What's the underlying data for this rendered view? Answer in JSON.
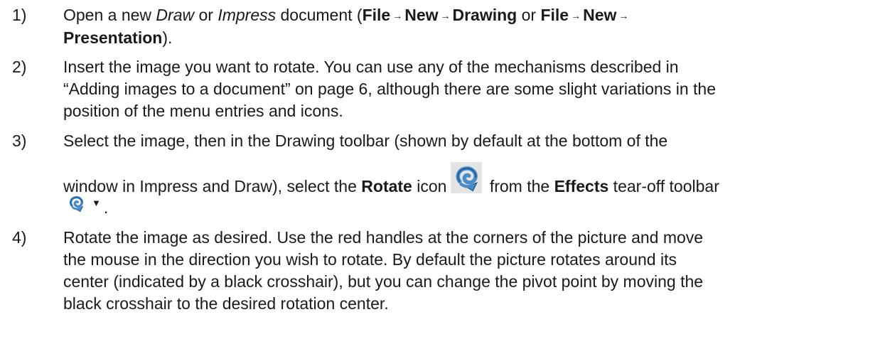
{
  "steps": [
    {
      "number": "1)",
      "lines": [
        [
          {
            "t": "Open a new "
          },
          {
            "t": "Draw",
            "s": "i"
          },
          {
            "t": " or "
          },
          {
            "t": "Impress",
            "s": "i"
          },
          {
            "t": " document ("
          },
          {
            "t": "File",
            "s": "b"
          },
          {
            "t": "→",
            "s": "arrow"
          },
          {
            "t": "New",
            "s": "b"
          },
          {
            "t": "→",
            "s": "arrow"
          },
          {
            "t": "Drawing",
            "s": "b"
          },
          {
            "t": " or "
          },
          {
            "t": "File",
            "s": "b"
          },
          {
            "t": "→",
            "s": "arrow"
          },
          {
            "t": "New",
            "s": "b"
          },
          {
            "t": "→",
            "s": "arrow"
          }
        ],
        [
          {
            "t": "Presentation",
            "s": "b"
          },
          {
            "t": ")."
          }
        ]
      ]
    },
    {
      "number": "2)",
      "lines": [
        [
          {
            "t": "Insert the image you want to rotate. You can use any of the mechanisms described in"
          }
        ],
        [
          {
            "t": "“Adding images to a document” on page 6, although there are some slight variations in the"
          }
        ],
        [
          {
            "t": "position of the menu entries and icons."
          }
        ]
      ]
    },
    {
      "number": "3)",
      "lines": [
        [
          {
            "t": "Select the image, then in the Drawing toolbar (shown by default at the bottom of the"
          }
        ],
        [
          {
            "t": "window in Impress and Draw), select the "
          },
          {
            "t": "Rotate",
            "s": "b"
          },
          {
            "t": " icon"
          },
          {
            "icon": "rotate-icon-large"
          },
          {
            "t": " from the "
          },
          {
            "t": "Effects",
            "s": "b"
          },
          {
            "t": " tear-off toolbar"
          }
        ],
        [
          {
            "icon": "rotate-icon-dropdown"
          },
          {
            "t": "."
          }
        ]
      ]
    },
    {
      "number": "4)",
      "lines": [
        [
          {
            "t": "Rotate the image as desired. Use the red handles at the corners of the picture and move"
          }
        ],
        [
          {
            "t": "the mouse in the direction you wish to rotate. By default the picture rotates around its"
          }
        ],
        [
          {
            "t": "center (indicated by a black crosshair), but you can change the pivot point by moving the"
          }
        ],
        [
          {
            "t": "black crosshair to the desired rotation center."
          }
        ]
      ]
    }
  ],
  "icons": {
    "rotate_color": "#4a8cc9",
    "rotate_dark": "#1f5f99"
  }
}
